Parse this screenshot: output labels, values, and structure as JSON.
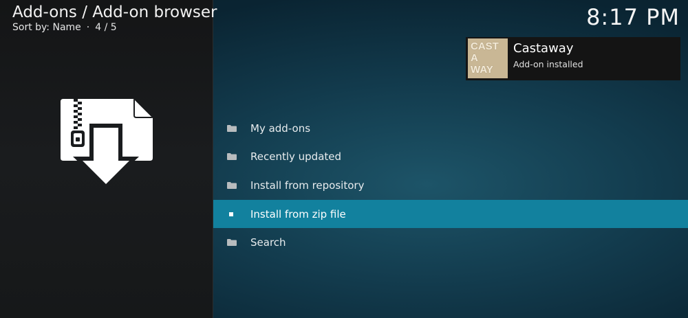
{
  "header": {
    "title": "Add-ons / Add-on browser",
    "sort_label": "Sort by: Name",
    "separator": "·",
    "position": "4 / 5"
  },
  "clock": "8:17 PM",
  "hero_icon": "zip-download-icon",
  "menu": {
    "items": [
      {
        "label": "My add-ons",
        "icon": "folder-icon",
        "selected": false
      },
      {
        "label": "Recently updated",
        "icon": "folder-icon",
        "selected": false
      },
      {
        "label": "Install from repository",
        "icon": "folder-icon",
        "selected": false
      },
      {
        "label": "Install from zip file",
        "icon": "square-icon",
        "selected": true
      },
      {
        "label": "Search",
        "icon": "folder-icon",
        "selected": false
      }
    ]
  },
  "notification": {
    "title": "Castaway",
    "subtitle": "Add-on installed",
    "thumb_lines": [
      "CAST",
      "A",
      "WAY"
    ]
  },
  "colors": {
    "selected_row": "#12819e",
    "left_panel": "#1a1c1e",
    "background": "#123a4c"
  }
}
